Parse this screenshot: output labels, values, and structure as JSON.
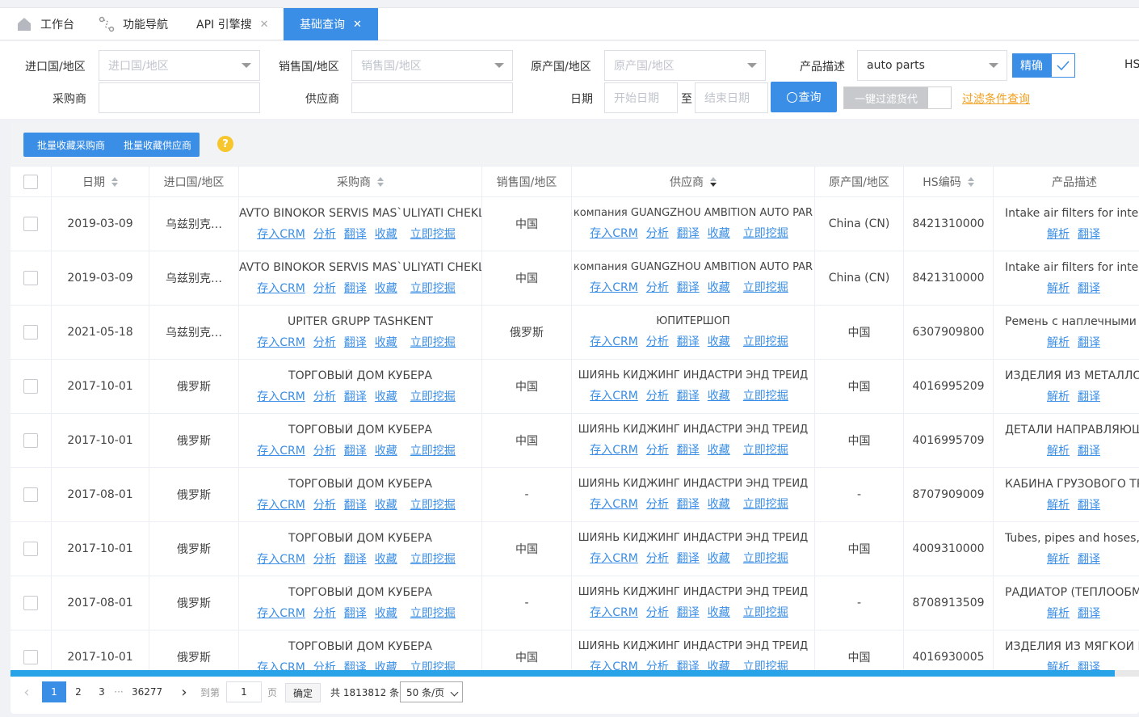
{
  "tabs": [
    {
      "label": "工作台",
      "icon": "home-icon"
    },
    {
      "label": "功能导航",
      "icon": "nav-icon"
    },
    {
      "label": "API 引擎搜",
      "close": "✕"
    },
    {
      "label": "基础查询",
      "close": "✕"
    }
  ],
  "filters": {
    "import_country": {
      "label": "进口国/地区",
      "placeholder": "进口国/地区"
    },
    "sales_country": {
      "label": "销售国/地区",
      "placeholder": "销售国/地区"
    },
    "origin_country": {
      "label": "原产国/地区",
      "placeholder": "原产国/地区"
    },
    "product_desc": {
      "label": "产品描述",
      "value": "auto parts"
    },
    "exact_label": "精确",
    "hs_label": "HS",
    "buyer": {
      "label": "采购商",
      "value": ""
    },
    "supplier": {
      "label": "供应商",
      "value": ""
    },
    "date": {
      "label": "日期",
      "start_placeholder": "开始日期",
      "sep": "至",
      "end_placeholder": "结束日期"
    },
    "query_button": "查询",
    "filter_forwarder_button": "一键过滤货代",
    "filter_conditions_link": "过滤条件查询"
  },
  "toolbar": {
    "batch_buyer": "批量收藏采购商",
    "batch_supplier": "批量收藏供应商",
    "help": "?"
  },
  "table": {
    "columns": [
      "日期",
      "进口国/地区",
      "采购商",
      "销售国/地区",
      "供应商",
      "原产国/地区",
      "HS编码",
      "产品描述"
    ],
    "party_links": [
      "存入CRM",
      "分析",
      "翻译",
      "收藏",
      "立即挖掘"
    ],
    "desc_links": [
      "解析",
      "翻译"
    ],
    "rows": [
      {
        "date": "2019-03-09",
        "import_country": "乌兹别克…",
        "buyer": "AVTO BINOKOR SERVIS MAS`ULIYATI CHEKL",
        "sales_country": "中国",
        "supplier": "компания GUANGZHOU AMBITION AUTO PAR",
        "origin": "China (CN)",
        "hs": "8421310000",
        "desc": "Intake air filters for intern"
      },
      {
        "date": "2019-03-09",
        "import_country": "乌兹别克…",
        "buyer": "AVTO BINOKOR SERVIS MAS`ULIYATI CHEKL",
        "sales_country": "中国",
        "supplier": "компания GUANGZHOU AMBITION AUTO PAR",
        "origin": "China (CN)",
        "hs": "8421310000",
        "desc": "Intake air filters for intern"
      },
      {
        "date": "2021-05-18",
        "import_country": "乌兹别克…",
        "buyer": "UPITER GRUPP TASHKENT",
        "sales_country": "俄罗斯",
        "supplier": "ЮПИТЕРШОП",
        "origin": "中国",
        "hs": "6307909800",
        "desc": "Ремень с наплечными ля"
      },
      {
        "date": "2017-10-01",
        "import_country": "俄罗斯",
        "buyer": "ТОРГОВЫЙ ДОМ КУБЕРА",
        "sales_country": "中国",
        "supplier": "ШИЯНЬ КИДЖИНГ ИНДАСТРИ ЭНД ТРЕЙД",
        "origin": "中国",
        "hs": "4016995209",
        "desc": "ИЗДЕЛИЯ ИЗ МЕТАЛЛОН"
      },
      {
        "date": "2017-10-01",
        "import_country": "俄罗斯",
        "buyer": "ТОРГОВЫЙ ДОМ КУБЕРА",
        "sales_country": "中国",
        "supplier": "ШИЯНЬ КИДЖИНГ ИНДАСТРИ ЭНД ТРЕЙД",
        "origin": "中国",
        "hs": "4016995709",
        "desc": "ДЕТАЛИ НАПРАВЛЯЮЩ"
      },
      {
        "date": "2017-08-01",
        "import_country": "俄罗斯",
        "buyer": "ТОРГОВЫЙ ДОМ КУБЕРА",
        "sales_country": "-",
        "supplier": "ШИЯНЬ КИДЖИНГ ИНДАСТРИ ЭНД ТРЕЙД",
        "origin": "-",
        "hs": "8707909009",
        "desc": "КАБИНА ГРУЗОВОГО ТР"
      },
      {
        "date": "2017-10-01",
        "import_country": "俄罗斯",
        "buyer": "ТОРГОВЫЙ ДОМ КУБЕРА",
        "sales_country": "中国",
        "supplier": "ШИЯНЬ КИДЖИНГ ИНДАСТРИ ЭНД ТРЕЙД",
        "origin": "中国",
        "hs": "4009310000",
        "desc": "Tubes, pipes and hoses, o"
      },
      {
        "date": "2017-08-01",
        "import_country": "俄罗斯",
        "buyer": "ТОРГОВЫЙ ДОМ КУБЕРА",
        "sales_country": "-",
        "supplier": "ШИЯНЬ КИДЖИНГ ИНДАСТРИ ЭНД ТРЕЙД",
        "origin": "-",
        "hs": "8708913509",
        "desc": "РАДИАТОР (ТЕПЛООБМЕ"
      },
      {
        "date": "2017-10-01",
        "import_country": "俄罗斯",
        "buyer": "ТОРГОВЫЙ ДОМ КУБЕРА",
        "sales_country": "中国",
        "supplier": "ШИЯНЬ КИДЖИНГ ИНДАСТРИ ЭНД ТРЕЙД",
        "origin": "中国",
        "hs": "4016930005",
        "desc": "ИЗДЕЛИЯ ИЗ МЯГКОЙ ВУ"
      }
    ]
  },
  "pagination": {
    "prev": "‹",
    "pages": [
      "1",
      "2",
      "3"
    ],
    "ellipsis": "···",
    "last": "36277",
    "next": "›",
    "goto_label": "到第",
    "goto_value": "1",
    "page_unit": "页",
    "confirm": "确定",
    "total": "共 1813812 条",
    "page_size": "50 条/页"
  },
  "colors": {
    "accent": "#3a8ee6",
    "link": "#3a8ee6",
    "warning_link": "#f0a020",
    "help_badge": "#f7c52c"
  }
}
